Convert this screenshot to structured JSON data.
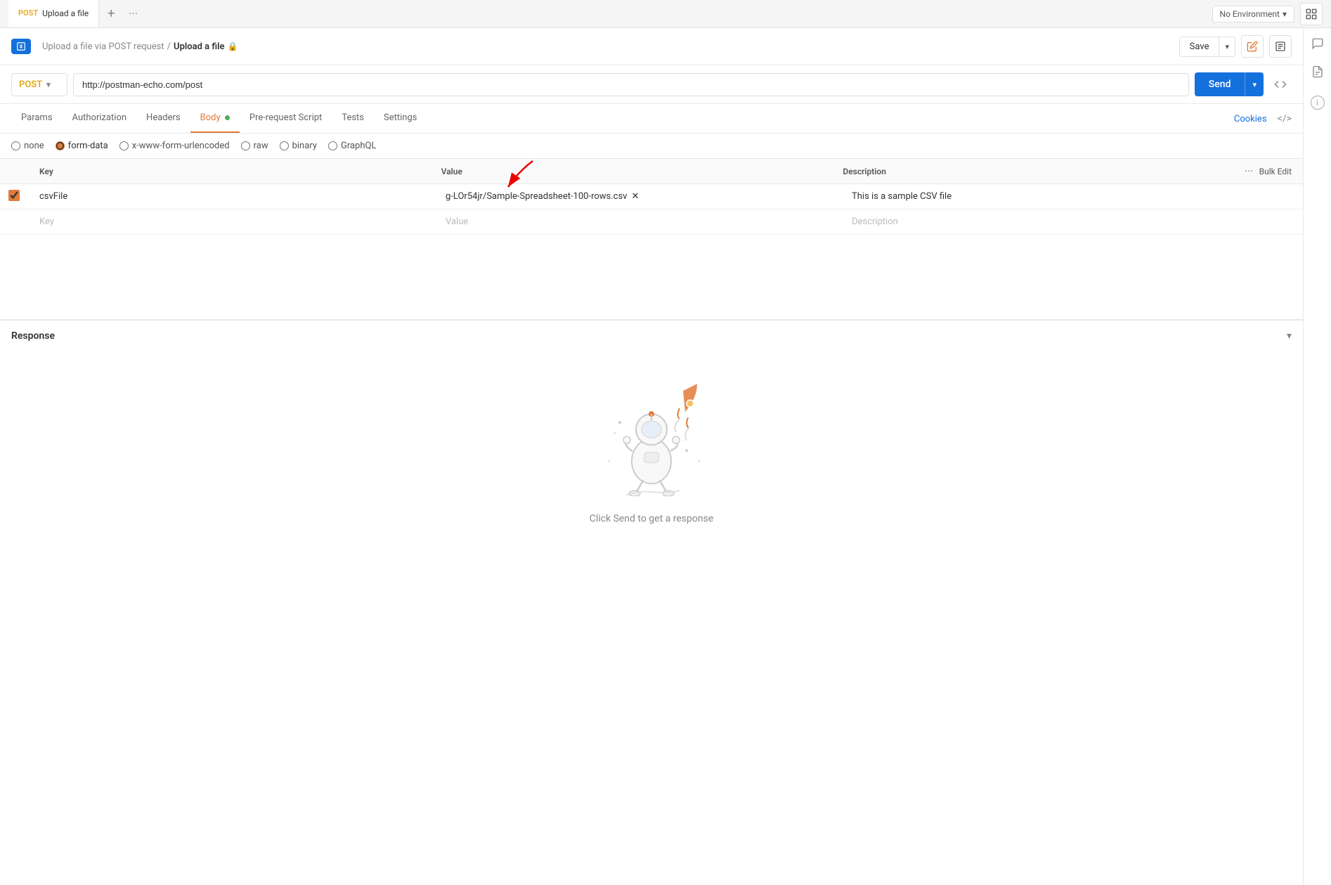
{
  "tabBar": {
    "method": "POST",
    "tabTitle": "Upload a file",
    "addIcon": "+",
    "moreIcon": "···",
    "environment": {
      "label": "No Environment",
      "chevron": "▾"
    }
  },
  "requestHeader": {
    "breadcrumb": "Upload a file via POST request",
    "separator": "/",
    "current": "Upload a file",
    "lockIcon": "🔒",
    "saveLabel": "Save",
    "saveChevron": "▾",
    "editIcon": "✏",
    "descIcon": "☰"
  },
  "urlBar": {
    "method": "POST",
    "chevron": "▾",
    "url": "http://postman-echo.com/post",
    "sendLabel": "Send",
    "sendChevron": "▾"
  },
  "tabs": {
    "items": [
      {
        "label": "Params",
        "active": false
      },
      {
        "label": "Authorization",
        "active": false
      },
      {
        "label": "Headers",
        "active": false
      },
      {
        "label": "Body",
        "active": true,
        "dot": true
      },
      {
        "label": "Pre-request Script",
        "active": false
      },
      {
        "label": "Tests",
        "active": false
      },
      {
        "label": "Settings",
        "active": false
      }
    ],
    "cookies": "Cookies",
    "codeIcon": "</>"
  },
  "bodyTypes": [
    {
      "id": "none",
      "label": "none",
      "selected": false
    },
    {
      "id": "form-data",
      "label": "form-data",
      "selected": true
    },
    {
      "id": "x-www-form-urlencoded",
      "label": "x-www-form-urlencoded",
      "selected": false
    },
    {
      "id": "raw",
      "label": "raw",
      "selected": false
    },
    {
      "id": "binary",
      "label": "binary",
      "selected": false
    },
    {
      "id": "graphql",
      "label": "GraphQL",
      "selected": false
    }
  ],
  "table": {
    "headers": {
      "key": "Key",
      "value": "Value",
      "description": "Description",
      "bulkEdit": "Bulk Edit"
    },
    "rows": [
      {
        "checked": true,
        "key": "csvFile",
        "value": "g-LOr54jr/Sample-Spreadsheet-100-rows.csv",
        "description": "This is a sample CSV file"
      }
    ],
    "emptyRow": {
      "key": "Key",
      "value": "Value",
      "description": "Description"
    }
  },
  "response": {
    "title": "Response",
    "chevron": "▾",
    "emptyText": "Click Send to get a response"
  },
  "rightSidebar": {
    "commentIcon": "💬",
    "docIcon": "📄",
    "infoIcon": "ℹ"
  }
}
